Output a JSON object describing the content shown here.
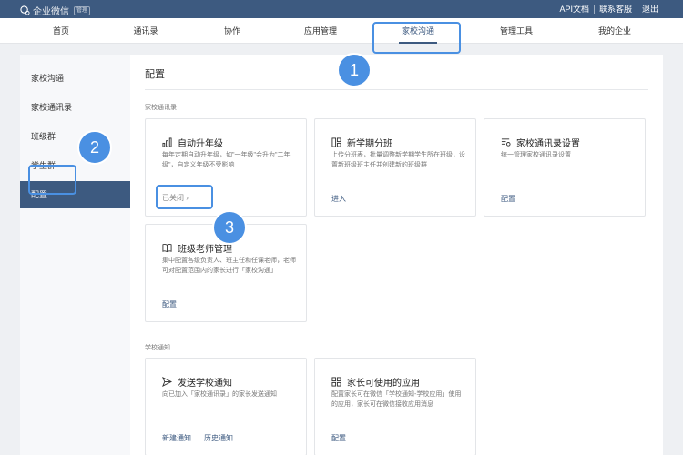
{
  "topbar": {
    "brand": "企业微信",
    "badge": "管理",
    "links": [
      "API文档",
      "联系客服",
      "退出"
    ]
  },
  "nav": {
    "items": [
      "首页",
      "通讯录",
      "协作",
      "应用管理",
      "家校沟通",
      "管理工具",
      "我的企业"
    ],
    "active": "家校沟通"
  },
  "sidebar": {
    "items": [
      "家校沟通",
      "家校通讯录",
      "班级群",
      "学生群",
      "配置"
    ],
    "active": "配置"
  },
  "main": {
    "title": "配置",
    "section1": "家校通讯录",
    "section2": "学校通知",
    "cards": [
      {
        "icon": "bar-chart-icon",
        "title": "自动升年级",
        "desc": "每年定期自动升年级，如\"一年级\"会升为\"二年级\"，自定义年级不受影响",
        "action": "已关闭 ›"
      },
      {
        "icon": "grid-icon",
        "title": "新学期分班",
        "desc": "上传分班表，批量调整新学期学生所在班级，设置新班级班主任并创建新的班级群",
        "action": "进入"
      },
      {
        "icon": "list-settings-icon",
        "title": "家校通讯录设置",
        "desc": "统一管理家校通讯录设置",
        "action": "配置"
      },
      {
        "icon": "book-icon",
        "title": "班级老师管理",
        "desc": "集中配置各级负责人、班主任和任课老师，老师可对配置范围内的家长进行「家校沟通」",
        "action": "配置"
      },
      {
        "icon": "send-icon",
        "title": "发送学校通知",
        "desc": "向已加入「家校通讯录」的家长发送通知",
        "actions": [
          "新建通知",
          "历史通知"
        ]
      },
      {
        "icon": "apps-icon",
        "title": "家长可使用的应用",
        "desc": "配置家长可在微信「学校通知-学校应用」使用的应用，家长可在微信接收应用消息",
        "action": "配置"
      }
    ]
  },
  "markers": [
    "1",
    "2",
    "3"
  ],
  "colors": {
    "brand": "#3d5a80",
    "highlight": "#4a90e2"
  }
}
